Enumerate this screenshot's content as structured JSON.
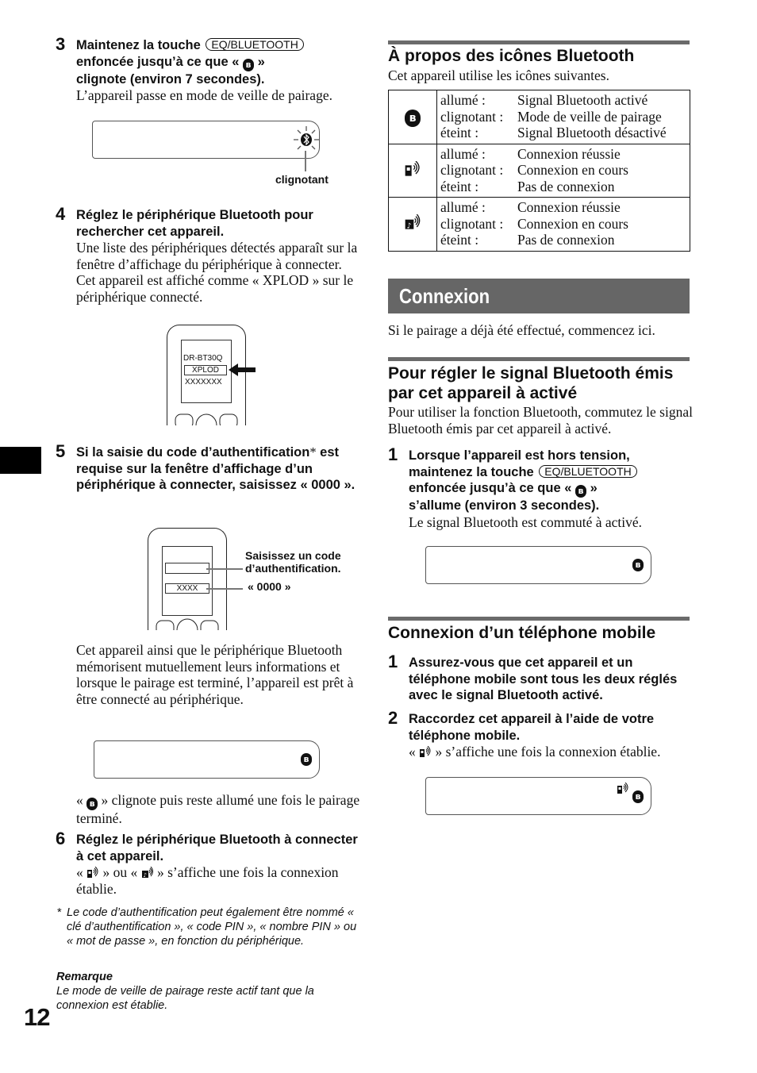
{
  "page": {
    "number": "12",
    "key_label": "EQ/BLUETOOTH"
  },
  "left": {
    "step3": {
      "num": "3",
      "head_a": "Maintenez la touche",
      "head_b": "enfoncée jusqu’à ce que «",
      "head_c": "»",
      "head_d": "clignote (environ 7 secondes).",
      "body": "L’appareil passe en mode de veille de pairage.",
      "callout": "clignotant"
    },
    "step4": {
      "num": "4",
      "head": "Réglez le périphérique Bluetooth pour rechercher cet appareil.",
      "body": "Une liste des périphériques détectés apparaît sur la fenêtre d’affichage du périphérique à connecter. Cet appareil est affiché comme « XPLOD » sur le périphérique connecté.",
      "phone_lines": [
        "DR-BT30Q",
        "XPLOD",
        "XXXXXXX"
      ]
    },
    "step5": {
      "num": "5",
      "head_a": "Si la saisie du code d’authentification",
      "asterisk": "*",
      "head_b": "est requise sur la fenêtre d’affichage d’un périphérique à connecter, saisissez « 0000 ».",
      "phone_field": "XXXX",
      "callout_a": "Saisissez un code d’authentification.",
      "callout_b": "« 0000 »",
      "body": "Cet appareil ainsi que le périphérique Bluetooth mémorisent mutuellement leurs informations et lorsque le pairage est terminé, l’appareil est prêt à être connecté au périphérique.",
      "after_a": "«",
      "after_b": "» clignote puis reste allumé une fois le pairage terminé."
    },
    "step6": {
      "num": "6",
      "head": "Réglez le périphérique Bluetooth à connecter à cet appareil.",
      "body_a": "«",
      "body_b": "» ou «",
      "body_c": "» s’affiche une fois la connexion établie."
    },
    "footnote": {
      "mark": "*",
      "text": "Le code d’authentification peut également être nommé « clé d’authentification », « code PIN », « nombre PIN » ou « mot de passe », en fonction du périphérique."
    },
    "note": {
      "title": "Remarque",
      "text": "Le mode de veille de pairage reste actif tant que la connexion est établie."
    }
  },
  "right": {
    "icons_section": {
      "title": "À propos des icônes Bluetooth",
      "intro": "Cet appareil utilise les icônes suivantes.",
      "rows": [
        {
          "icon": "bluetooth-icon",
          "items": [
            [
              "allumé :",
              "Signal Bluetooth activé"
            ],
            [
              "clignotant :",
              "Mode de veille de pairage"
            ],
            [
              "éteint :",
              "Signal Bluetooth désactivé"
            ]
          ]
        },
        {
          "icon": "phone-signal-icon",
          "items": [
            [
              "allumé :",
              "Connexion réussie"
            ],
            [
              "clignotant :",
              "Connexion en cours"
            ],
            [
              "éteint :",
              "Pas de connexion"
            ]
          ]
        },
        {
          "icon": "audio-signal-icon",
          "items": [
            [
              "allumé :",
              "Connexion réussie"
            ],
            [
              "clignotant :",
              "Connexion en cours"
            ],
            [
              "éteint :",
              "Pas de connexion"
            ]
          ]
        }
      ]
    },
    "connexion": {
      "banner": "Connexion",
      "intro": "Si le pairage a déjà été effectué, commencez ici."
    },
    "signal_section": {
      "title": "Pour régler le signal Bluetooth émis par cet appareil à activé",
      "intro": "Pour utiliser la fonction Bluetooth, commutez le signal Bluetooth émis par cet appareil à activé.",
      "step1": {
        "num": "1",
        "head_a": "Lorsque l’appareil est hors tension, maintenez la touche",
        "head_b": "enfoncée jusqu’à ce que «",
        "head_c": "»",
        "head_d": "s’allume (environ 3 secondes).",
        "body": "Le signal Bluetooth est commuté à activé."
      }
    },
    "mobile_section": {
      "title": "Connexion d’un téléphone mobile",
      "step1": {
        "num": "1",
        "head": "Assurez-vous que cet appareil et un téléphone mobile sont tous les deux réglés avec le signal Bluetooth activé."
      },
      "step2": {
        "num": "2",
        "head": "Raccordez cet appareil à l’aide de votre téléphone mobile.",
        "body_a": "«",
        "body_b": "» s’affiche une fois la connexion établie."
      }
    }
  }
}
